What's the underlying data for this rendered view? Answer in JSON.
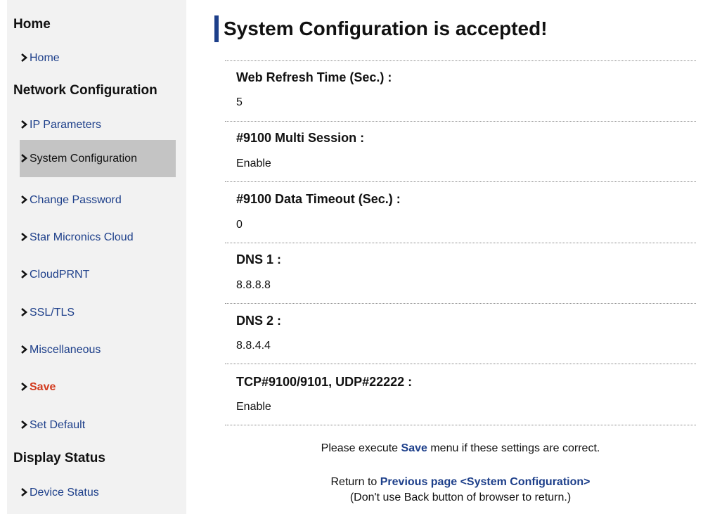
{
  "sidebar": {
    "sections": [
      {
        "heading": "Home",
        "items": [
          {
            "label": "Home"
          }
        ]
      },
      {
        "heading": "Network Configuration",
        "items": [
          {
            "label": "IP Parameters"
          },
          {
            "label": "System Configuration",
            "active": true
          },
          {
            "label": "Change Password"
          },
          {
            "label": "Star Micronics Cloud"
          },
          {
            "label": "CloudPRNT"
          },
          {
            "label": "SSL/TLS"
          },
          {
            "label": "Miscellaneous"
          },
          {
            "label": "Save",
            "highlight": true
          },
          {
            "label": "Set Default"
          }
        ]
      },
      {
        "heading": "Display Status",
        "items": [
          {
            "label": "Device Status"
          }
        ]
      }
    ],
    "icon": "chevron-right-icon"
  },
  "main": {
    "title": "System Configuration is accepted!",
    "fields": [
      {
        "label": "Web Refresh Time (Sec.) :",
        "value": "5"
      },
      {
        "label": "#9100 Multi Session :",
        "value": "Enable"
      },
      {
        "label": "#9100 Data Timeout (Sec.) :",
        "value": "0"
      },
      {
        "label": "DNS 1 :",
        "value": "8.8.8.8"
      },
      {
        "label": "DNS 2 :",
        "value": "8.8.4.4"
      },
      {
        "label": "TCP#9100/9101, UDP#22222 :",
        "value": "Enable"
      }
    ],
    "notice": {
      "prefix": "Please execute ",
      "link": "Save",
      "suffix": " menu if these settings are correct."
    },
    "return": {
      "prefix": "Return to ",
      "link": "Previous page <System Configuration>",
      "note": "(Don't use Back button of browser to return.)"
    }
  },
  "colors": {
    "accent": "#1d3f8a",
    "save": "#d23a1e",
    "sidebar_bg": "#f2f2f2",
    "active_bg": "#c4c4c4"
  }
}
